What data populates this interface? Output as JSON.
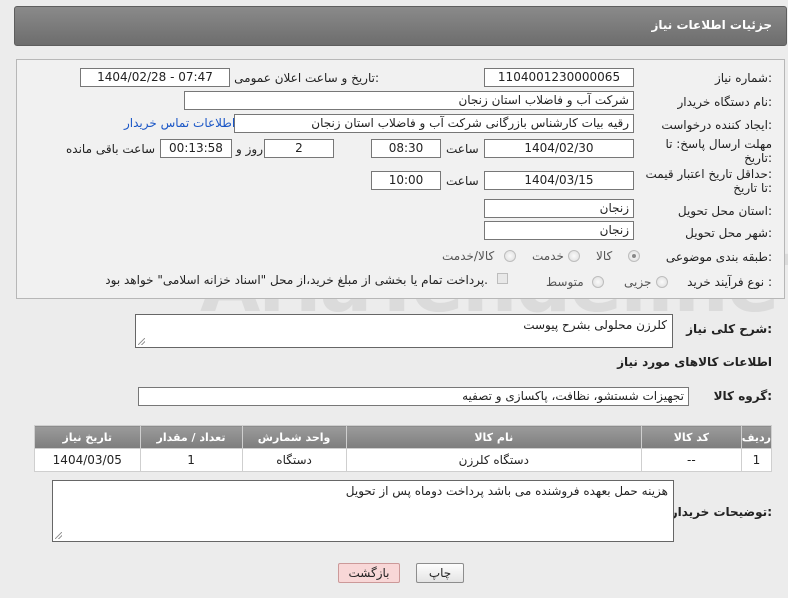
{
  "header": {
    "title": "جزئیات اطلاعات نیاز"
  },
  "form": {
    "need_number": {
      "label": "شماره نیاز:",
      "value": "1104001230000065"
    },
    "announce_datetime": {
      "label": "تاریخ و ساعت اعلان عمومی:",
      "value": "1404/02/28 - 07:47"
    },
    "buyer_org": {
      "label": "نام دستگاه خریدار:",
      "value": "شرکت آب و فاضلاب استان زنجان"
    },
    "requester": {
      "label": "ایجاد کننده درخواست:",
      "value": "رقیه بیات کارشناس بازرگانی شرکت آب و فاضلاب استان زنجان",
      "contact_link": "اطلاعات تماس خریدار"
    },
    "reply_deadline": {
      "label_line1": "مهلت ارسال پاسخ: تا",
      "label_line2": "تاریخ:",
      "date": "1404/02/30",
      "time_label": "ساعت",
      "time": "08:30",
      "days": "2",
      "days_label": "روز و",
      "remaining": "00:13:58",
      "remaining_label": "ساعت باقی مانده"
    },
    "price_validity": {
      "label_line1": "حداقل تاریخ اعتبار قیمت:",
      "label_line2": "تا تاریخ:",
      "date": "1404/03/15",
      "time_label": "ساعت",
      "time": "10:00"
    },
    "delivery_province": {
      "label": "استان محل تحویل:",
      "value": "زنجان"
    },
    "delivery_city": {
      "label": "شهر محل تحویل:",
      "value": "زنجان"
    },
    "category": {
      "label": "طبقه بندی موضوعی:",
      "options": [
        "کالا",
        "خدمت",
        "کالا/خدمت"
      ],
      "selected": "کالا"
    },
    "purchase_type": {
      "label": "نوع فرآیند خرید :",
      "options": [
        "جزیی",
        "متوسط"
      ],
      "checkbox_label": "پرداخت تمام یا بخشی از مبلغ خرید،از محل \"اسناد خزانه اسلامی\" خواهد بود."
    }
  },
  "summary": {
    "label": "شرح کلی نیاز:",
    "value": "کلرزن محلولی بشرح پیوست"
  },
  "goods_info": {
    "title": "اطلاعات کالاهای مورد نیاز",
    "group_label": "گروه کالا:",
    "group_value": "تجهیزات شستشو، نظافت، پاکسازی و تصفیه",
    "table": {
      "headers": [
        "ردیف",
        "کد کالا",
        "نام کالا",
        "واحد شمارش",
        "تعداد / مقدار",
        "تاریخ نیاز"
      ],
      "rows": [
        [
          "1",
          "--",
          "دستگاه کلرزن",
          "دستگاه",
          "1",
          "1404/03/05"
        ]
      ]
    }
  },
  "buyer_notes": {
    "label": "توضیحات خریدار:",
    "value": "هزینه حمل بعهده فروشنده می باشد پرداخت دوماه پس از تحویل"
  },
  "buttons": {
    "print": "چاپ",
    "back": "بازگشت"
  },
  "watermark": "AriaTender.neT",
  "colors": {
    "header_bg": "#7a7a7a",
    "back_button_bg": "#f8d7d7",
    "link": "#1a56c6"
  }
}
